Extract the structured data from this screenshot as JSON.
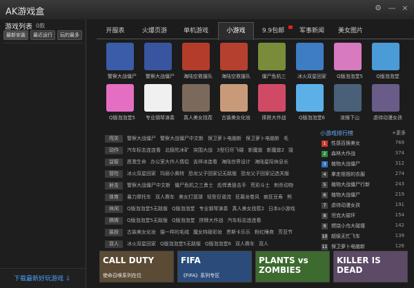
{
  "app": {
    "title": "AK游戏盒"
  },
  "window": {
    "settings_icon": "gear-icon",
    "minimize": "—",
    "close": "×"
  },
  "sidebar": {
    "title": "游戏列表",
    "count": "0款",
    "tabs": [
      "最新安装",
      "最近运行",
      "玩的最多"
    ],
    "footer": "下载最新好玩游戏 ⇩"
  },
  "tabs": [
    {
      "label": "开服表"
    },
    {
      "label": "火爆页游"
    },
    {
      "label": "单机游戏"
    },
    {
      "label": "小游戏",
      "active": true
    },
    {
      "label": "9.9包邮",
      "badge": true
    },
    {
      "label": "军事新闻"
    },
    {
      "label": "美女图片"
    }
  ],
  "games": [
    {
      "label": "警察大战僵尸",
      "color": "#3b5ca8"
    },
    {
      "label": "警察大战僵尸",
      "color": "#3955a0"
    },
    {
      "label": "海陆空救援队",
      "color": "#b43c2a"
    },
    {
      "label": "海陆空救援队",
      "color": "#b54030"
    },
    {
      "label": "僵尸危机三",
      "color": "#7a8b3a"
    },
    {
      "label": "冰火双星回家",
      "color": "#3e7cc4"
    },
    {
      "label": "Q版泡泡堂5",
      "color": "#d77ac0"
    },
    {
      "label": "Q版泡泡堂",
      "color": "#4a9bd6"
    },
    {
      "label": "Q版泡泡堂5",
      "color": "#e46fc2"
    },
    {
      "label": "专业钢琴演奏",
      "color": "#f0f0f0"
    },
    {
      "label": "真人美女找茬",
      "color": "#7b6a5c"
    },
    {
      "label": "古装美女化妆",
      "color": "#c99a7a"
    },
    {
      "label": "摔跌大作战",
      "color": "#d04a66"
    },
    {
      "label": "Q版泡泡堂6",
      "color": "#5bb0e8"
    },
    {
      "label": "泼猴下山",
      "color": "#4a6078"
    },
    {
      "label": "虐待动漫女孩",
      "color": "#6a5c88"
    }
  ],
  "categories": [
    {
      "name": "闯关",
      "links": [
        "警察大战僵尸",
        "警察大战僵尸中文新",
        "保卫萝卜电脑新",
        "保卫萝卜电脑新",
        "毛"
      ]
    },
    {
      "name": "动作",
      "links": [
        "汽车标志连连看",
        "北极陀冰矿",
        "突围大战",
        "3型归尽飞碟",
        "新魔兽",
        "新魔兽2",
        "毁"
      ]
    },
    {
      "name": "益智",
      "links": [
        "愿激生命",
        "办公室大作人情侣",
        "吉祥冰连看",
        "海陆世界设计",
        "海陆星际休息长"
      ]
    },
    {
      "name": "冒险",
      "links": [
        "冰火双星回家",
        "玛丽小奥特",
        "恐龙父子回家记无敌版",
        "恐龙父子回家记选关版"
      ]
    },
    {
      "name": "射击",
      "links": [
        "警察大战僵尸中文新",
        "僵尸危机之三勇士",
        "彪悍勇狙击手",
        "荒彩斗士",
        "刺杀动物"
      ]
    },
    {
      "name": "体育",
      "links": [
        "暴力摩托车",
        "双人赛车",
        "美女打篮球",
        "轻型巨诺流",
        "狂幕龙卷风",
        "疯狂豆寿",
        "熊"
      ]
    },
    {
      "name": "休闲",
      "links": [
        "Q版泡泡堂5无敌版",
        "Q版泡泡堂",
        "专业钢琴演奏",
        "真人美女找茬2",
        "日本s小游戏"
      ]
    },
    {
      "name": "棋牌",
      "links": [
        "Q版泡泡堂5无敌版",
        "Q版泡泡堂",
        "拼牌大作战",
        "汽车标志连连看"
      ]
    },
    {
      "name": "装扮",
      "links": [
        "古装美女化妆",
        "猫一样的毛绒",
        "魔女特敲彩妆",
        "贵斯卡乐乐",
        "粉红睡商",
        "芳亚节"
      ]
    },
    {
      "name": "双人",
      "links": [
        "冰火双星回家",
        "Q版泡泡堂5无敌版",
        "Q版泡泡堂6",
        "双人赛车",
        "双人"
      ]
    }
  ],
  "ranking": {
    "title": "小游戏排行榜",
    "more": "+更多",
    "items": [
      {
        "rank": "1",
        "name": "性感百换美女",
        "count": "769",
        "color": "#d0382c"
      },
      {
        "rank": "2",
        "name": "森林大作战",
        "count": "374",
        "color": "#2d8a3a"
      },
      {
        "rank": "3",
        "name": "植物大战僵尸",
        "count": "312",
        "color": "#2f6fc2"
      },
      {
        "rank": "4",
        "name": "拿走祖祖的衣服",
        "count": "274",
        "color": "#444444"
      },
      {
        "rank": "5",
        "name": "植物大战僵尸行新",
        "count": "243",
        "color": "#444444"
      },
      {
        "rank": "6",
        "name": "植物大战僵尸",
        "count": "219",
        "color": "#444444"
      },
      {
        "rank": "7",
        "name": "虐待动漫女孩",
        "count": "191",
        "color": "#444444"
      },
      {
        "rank": "8",
        "name": "坦克大碰环",
        "count": "154",
        "color": "#444444"
      },
      {
        "rank": "9",
        "name": "燃烧小鸟大碰撞",
        "count": "142",
        "color": "#444444"
      },
      {
        "rank": "10",
        "name": "超级无忙飞车",
        "count": "139",
        "color": "#444444"
      },
      {
        "rank": "11",
        "name": "保卫萝卜电脑新",
        "count": "126",
        "color": "#444444"
      }
    ]
  },
  "banners": [
    {
      "title": "CALL DUTY",
      "sub": "使命召唤系列在位",
      "color": "#5b4a34"
    },
    {
      "title": "FIFA",
      "sub": "《FIFA》系列专区",
      "color": "#2b4c7a"
    },
    {
      "title": "PLANTS vs ZOMBIES",
      "sub": "",
      "color": "#3d6a2e"
    },
    {
      "title": "KILLER IS DEAD",
      "sub": "",
      "color": "#5c4a66"
    }
  ]
}
